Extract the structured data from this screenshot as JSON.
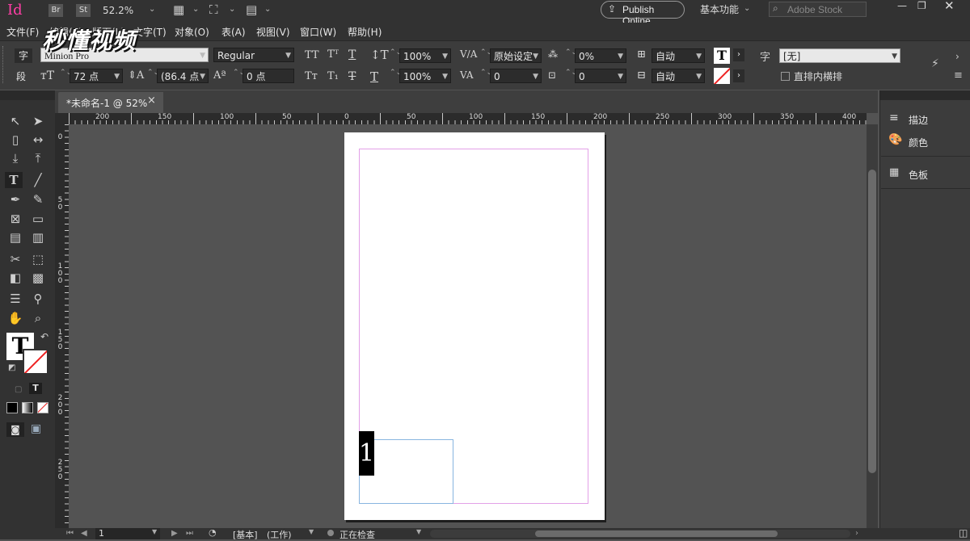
{
  "appbar": {
    "logo": "Id",
    "bridge": "Br",
    "stock_btn": "St",
    "zoom": "52.2%",
    "publish": "Publish Online",
    "workspace": "基本功能",
    "search_placeholder": "Adobe Stock",
    "watermark": "秒懂视频"
  },
  "menu": {
    "items": [
      "文件(F)",
      "编辑(E)",
      "版面(L)",
      "文字(T)",
      "对象(O)",
      "表(A)",
      "视图(V)",
      "窗口(W)",
      "帮助(H)"
    ]
  },
  "control": {
    "char_mode": "字",
    "para_mode": "段",
    "font_family": "Minion Pro",
    "font_style": "Regular",
    "font_size": "72 点",
    "leading": "(86.4 点",
    "kerning_tt": "TT",
    "superscript": "T",
    "tracking_field": "0 点",
    "vscale": "100%",
    "hscale": "100%",
    "kerning_method": "原始设定",
    "tracking": "0",
    "baseline": "0%",
    "skew": "0",
    "auto1": "自动",
    "auto2": "自动",
    "char_style_label": "字",
    "char_style": "[无]",
    "vertical_check": "直排内横排"
  },
  "tab": {
    "title": "*未命名-1 @ 52%",
    "close": "×"
  },
  "rulers": {
    "h_labels": [
      "200",
      "150",
      "100",
      "50",
      "0",
      "50",
      "100",
      "150",
      "200",
      "250",
      "300",
      "350",
      "400"
    ],
    "v_labels": [
      "0",
      "50",
      "100",
      "150",
      "200",
      "250"
    ]
  },
  "document": {
    "page_number_text": "1"
  },
  "panels": {
    "items": [
      "描边",
      "颜色",
      "色板"
    ]
  },
  "status": {
    "page": "1",
    "master": "[基本]",
    "work": "(工作)",
    "preflight": "正在检查"
  },
  "colors": {
    "accent_logo": "#ff3ea5",
    "margin_guide": "#e3a1e8",
    "frame_edge": "#88b5e0"
  }
}
